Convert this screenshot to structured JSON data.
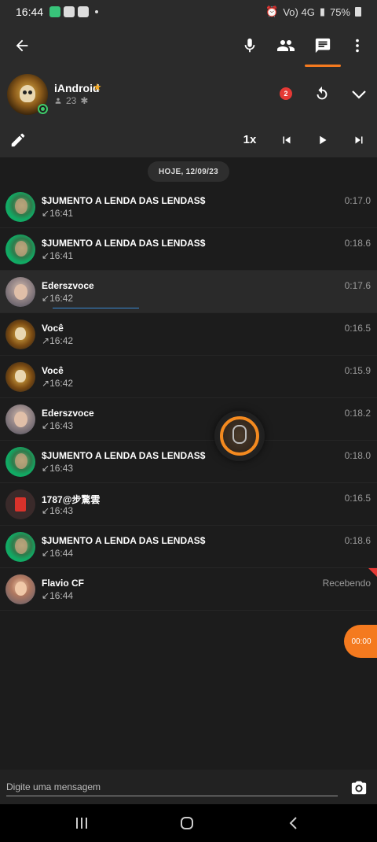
{
  "status_bar": {
    "time": "16:44",
    "carrier": "Vo) 4G",
    "battery": "75%"
  },
  "toolbar": {
    "active_tab": "messages",
    "icons": [
      "back-arrow-icon",
      "microphone-icon",
      "users-icon",
      "chat-icon",
      "more-vert-icon"
    ]
  },
  "channel": {
    "name": "iAndroid",
    "users_count": "23",
    "unread_badge": "2",
    "online": true
  },
  "playback": {
    "speed": "1x"
  },
  "date_divider": "HOJE, 12/09/23",
  "messages": [
    {
      "name": "$JUMENTO A LENDA DAS LENDAS$",
      "direction": "↙",
      "time": "16:41",
      "duration": "0:17.0",
      "avatar": "green"
    },
    {
      "name": "$JUMENTO A LENDA DAS LENDAS$",
      "direction": "↙",
      "time": "16:41",
      "duration": "0:18.6",
      "avatar": "green"
    },
    {
      "name": "Ederszvoce",
      "direction": "↙",
      "time": "16:42",
      "duration": "0:17.6",
      "avatar": "eder",
      "selected": true,
      "progress": 0.55
    },
    {
      "name": "Você",
      "direction": "↗",
      "time": "16:42",
      "duration": "0:16.5",
      "avatar": "voce"
    },
    {
      "name": "Você",
      "direction": "↗",
      "time": "16:42",
      "duration": "0:15.9",
      "avatar": "voce"
    },
    {
      "name": "Ederszvoce",
      "direction": "↙",
      "time": "16:43",
      "duration": "0:18.2",
      "avatar": "eder"
    },
    {
      "name": "$JUMENTO A LENDA DAS LENDAS$",
      "direction": "↙",
      "time": "16:43",
      "duration": "0:18.0",
      "avatar": "green"
    },
    {
      "name": "1787@步驚雲",
      "direction": "↙",
      "time": "16:43",
      "duration": "0:16.5",
      "avatar": "1787"
    },
    {
      "name": "$JUMENTO A LENDA DAS LENDAS$",
      "direction": "↙",
      "time": "16:44",
      "duration": "0:18.6",
      "avatar": "green"
    },
    {
      "name": "Flavio CF",
      "direction": "↙",
      "time": "16:44",
      "duration": "Recebendo",
      "avatar": "flavio",
      "receiving": true
    }
  ],
  "recording_timer": "00:00",
  "composer": {
    "placeholder": "Digite uma mensagem",
    "value": ""
  },
  "colors": {
    "accent": "#f47a1f",
    "background": "#1c1c1c",
    "bar": "#2b2b2b",
    "badge": "#e53935",
    "online": "#3ecb6a"
  }
}
